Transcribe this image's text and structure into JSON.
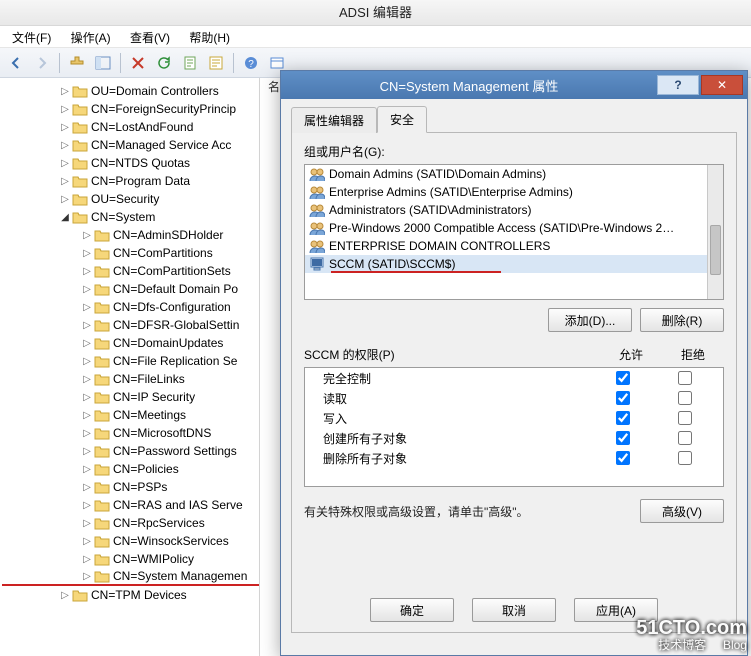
{
  "window": {
    "title": "ADSI 编辑器"
  },
  "menu": {
    "file": "文件(F)",
    "action": "操作(A)",
    "view": "查看(V)",
    "help": "帮助(H)"
  },
  "right_header": "名",
  "tree": {
    "items": [
      {
        "label": "OU=Domain Controllers",
        "indent": 56
      },
      {
        "label": "CN=ForeignSecurityPrincip",
        "indent": 56
      },
      {
        "label": "CN=LostAndFound",
        "indent": 56
      },
      {
        "label": "CN=Managed Service Acc",
        "indent": 56
      },
      {
        "label": "CN=NTDS Quotas",
        "indent": 56
      },
      {
        "label": "CN=Program Data",
        "indent": 56
      },
      {
        "label": "OU=Security",
        "indent": 56
      },
      {
        "label": "CN=System",
        "indent": 56,
        "expander": "◢",
        "expanded": true
      },
      {
        "label": "CN=AdminSDHolder",
        "indent": 78
      },
      {
        "label": "CN=ComPartitions",
        "indent": 78
      },
      {
        "label": "CN=ComPartitionSets",
        "indent": 78
      },
      {
        "label": "CN=Default Domain Po",
        "indent": 78
      },
      {
        "label": "CN=Dfs-Configuration",
        "indent": 78
      },
      {
        "label": "CN=DFSR-GlobalSettin",
        "indent": 78
      },
      {
        "label": "CN=DomainUpdates",
        "indent": 78
      },
      {
        "label": "CN=File Replication Se",
        "indent": 78
      },
      {
        "label": "CN=FileLinks",
        "indent": 78
      },
      {
        "label": "CN=IP Security",
        "indent": 78
      },
      {
        "label": "CN=Meetings",
        "indent": 78
      },
      {
        "label": "CN=MicrosoftDNS",
        "indent": 78
      },
      {
        "label": "CN=Password Settings",
        "indent": 78
      },
      {
        "label": "CN=Policies",
        "indent": 78
      },
      {
        "label": "CN=PSPs",
        "indent": 78
      },
      {
        "label": "CN=RAS and IAS Serve",
        "indent": 78
      },
      {
        "label": "CN=RpcServices",
        "indent": 78
      },
      {
        "label": "CN=WinsockServices",
        "indent": 78
      },
      {
        "label": "CN=WMIPolicy",
        "indent": 78
      },
      {
        "label": "CN=System Managemen",
        "indent": 78,
        "redline": true
      },
      {
        "label": "CN=TPM Devices",
        "indent": 56
      }
    ]
  },
  "dialog": {
    "title": "CN=System Management 属性",
    "tabs": {
      "attr": "属性编辑器",
      "sec": "安全"
    },
    "group_label": "组或用户名(G):",
    "principals": [
      {
        "icon": "group",
        "label": "Domain Admins (SATID\\Domain Admins)"
      },
      {
        "icon": "group",
        "label": "Enterprise Admins (SATID\\Enterprise Admins)"
      },
      {
        "icon": "group",
        "label": "Administrators (SATID\\Administrators)"
      },
      {
        "icon": "group",
        "label": "Pre-Windows 2000 Compatible Access (SATID\\Pre-Windows 2…"
      },
      {
        "icon": "group",
        "label": "ENTERPRISE DOMAIN CONTROLLERS"
      },
      {
        "icon": "computer",
        "label": "SCCM (SATID\\SCCM$)",
        "selected": true,
        "redline": true
      }
    ],
    "add_btn": "添加(D)...",
    "remove_btn": "删除(R)",
    "perm_header": "SCCM 的权限(P)",
    "allow": "允许",
    "deny": "拒绝",
    "permissions": [
      {
        "name": "完全控制",
        "allow": true,
        "deny": false
      },
      {
        "name": "读取",
        "allow": true,
        "deny": false
      },
      {
        "name": "写入",
        "allow": true,
        "deny": false
      },
      {
        "name": "创建所有子对象",
        "allow": true,
        "deny": false
      },
      {
        "name": "删除所有子对象",
        "allow": true,
        "deny": false
      }
    ],
    "note": "有关特殊权限或高级设置，请单击\"高级\"。",
    "advanced_btn": "高级(V)",
    "ok": "确定",
    "cancel": "取消",
    "apply": "应用(A)"
  },
  "watermark": {
    "big": "51CTO.com",
    "small": "技术博客     Blog"
  }
}
